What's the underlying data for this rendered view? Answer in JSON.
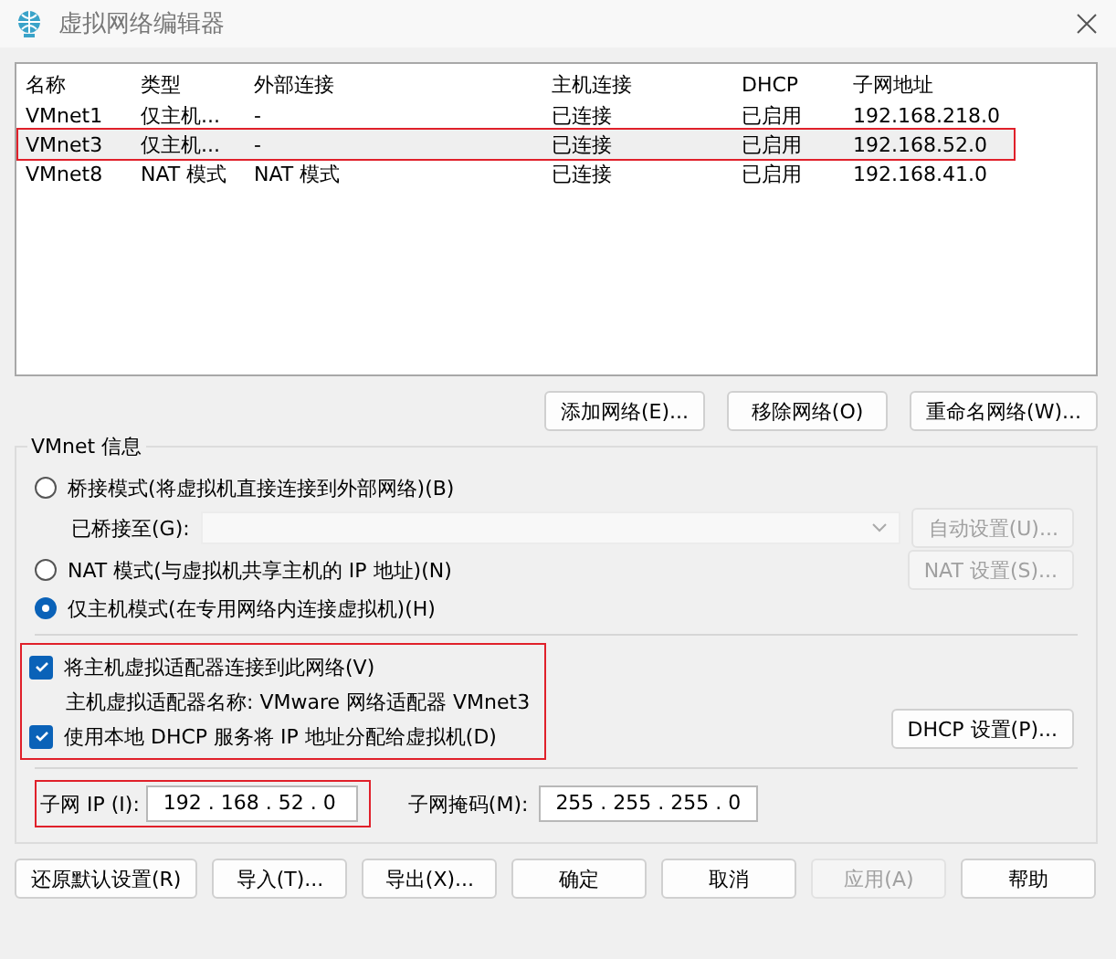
{
  "window": {
    "title": "虚拟网络编辑器"
  },
  "table": {
    "columns": [
      "名称",
      "类型",
      "外部连接",
      "主机连接",
      "DHCP",
      "子网地址"
    ],
    "rows": [
      {
        "cells": [
          "VMnet1",
          "仅主机...",
          "-",
          "已连接",
          "已启用",
          "192.168.218.0"
        ],
        "selected": false,
        "marked": false
      },
      {
        "cells": [
          "VMnet3",
          "仅主机...",
          "-",
          "已连接",
          "已启用",
          "192.168.52.0"
        ],
        "selected": true,
        "marked": true
      },
      {
        "cells": [
          "VMnet8",
          "NAT 模式",
          "NAT 模式",
          "已连接",
          "已启用",
          "192.168.41.0"
        ],
        "selected": false,
        "marked": false
      }
    ]
  },
  "table_buttons": [
    {
      "label": "添加网络(E)...",
      "disabled": false
    },
    {
      "label": "移除网络(O)",
      "disabled": false
    },
    {
      "label": "重命名网络(W)...",
      "disabled": false
    }
  ],
  "vmnet_info": {
    "title": "VMnet 信息",
    "modes": [
      {
        "label": "桥接模式(将虚拟机直接连接到外部网络)(B)",
        "selected": false
      },
      {
        "label": "NAT 模式(与虚拟机共享主机的 IP 地址)(N)",
        "selected": false
      },
      {
        "label": "仅主机模式(在专用网络内连接虚拟机)(H)",
        "selected": true
      }
    ],
    "bridged_to": {
      "label": "已桥接至(G):",
      "disabled": true
    },
    "auto_button": {
      "label": "自动设置(U)...",
      "disabled": true
    },
    "nat_button": {
      "label": "NAT 设置(S)...",
      "disabled": true
    },
    "host_options": {
      "marked": true,
      "connect_adapter": {
        "label": "将主机虚拟适配器连接到此网络(V)",
        "checked": true
      },
      "adapter_name": "主机虚拟适配器名称: VMware 网络适配器 VMnet3",
      "use_dhcp": {
        "label": "使用本地 DHCP 服务将 IP 地址分配给虚拟机(D)",
        "checked": true
      }
    },
    "dhcp_button": {
      "label": "DHCP 设置(P)...",
      "disabled": false
    },
    "subnet_ip": {
      "label": "子网 IP (I):",
      "value": "192 . 168 . 52 . 0",
      "marked": true
    },
    "subnet_mask": {
      "label": "子网掩码(M):",
      "value": "255 . 255 . 255 . 0"
    }
  },
  "footer_buttons": [
    {
      "label": "还原默认设置(R)",
      "disabled": false
    },
    {
      "label": "导入(T)...",
      "disabled": false
    },
    {
      "label": "导出(X)...",
      "disabled": false
    },
    {
      "label": "确定",
      "disabled": false
    },
    {
      "label": "取消",
      "disabled": false
    },
    {
      "label": "应用(A)",
      "disabled": true
    },
    {
      "label": "帮助",
      "disabled": false
    }
  ]
}
